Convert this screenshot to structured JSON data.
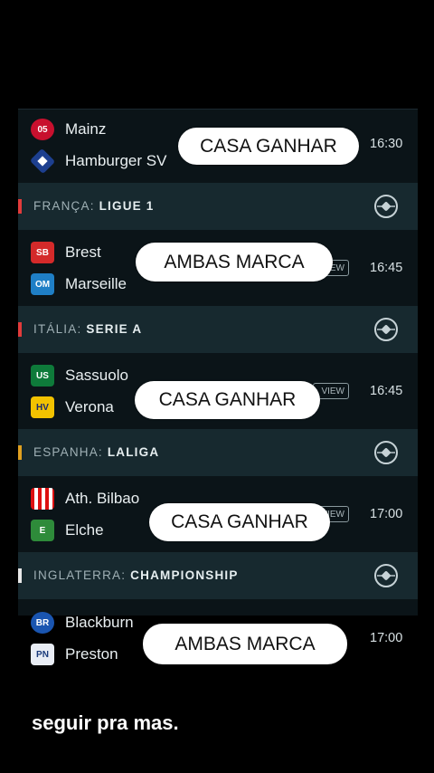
{
  "matches": [
    {
      "home": "Mainz",
      "away": "Hamburger SV",
      "time": "16:30",
      "tip": "CASA GANHAR"
    },
    {
      "home": "Brest",
      "away": "Marseille",
      "time": "16:45",
      "tip": "AMBAS MARCA"
    },
    {
      "home": "Sassuolo",
      "away": "Verona",
      "time": "16:45",
      "tip": "CASA GANHAR"
    },
    {
      "home": "Ath. Bilbao",
      "away": "Elche",
      "time": "17:00",
      "tip": "CASA GANHAR"
    },
    {
      "home": "Blackburn",
      "away": "Preston",
      "time": "17:00",
      "tip": "AMBAS MARCA"
    }
  ],
  "leagues": [
    {
      "country": "FRANÇA:",
      "name": "LIGUE 1",
      "flag_color": "#e23b3b"
    },
    {
      "country": "ITÁLIA:",
      "name": "SERIE A",
      "flag_color": "#e23b3b"
    },
    {
      "country": "ESPANHA:",
      "name": "LALIGA",
      "flag_color": "#e0a020"
    },
    {
      "country": "INGLATERRA:",
      "name": "CHAMPIONSHIP",
      "flag_color": "#e8e8e8"
    }
  ],
  "preview_label": "VIEW",
  "footer": "seguir pra mas."
}
